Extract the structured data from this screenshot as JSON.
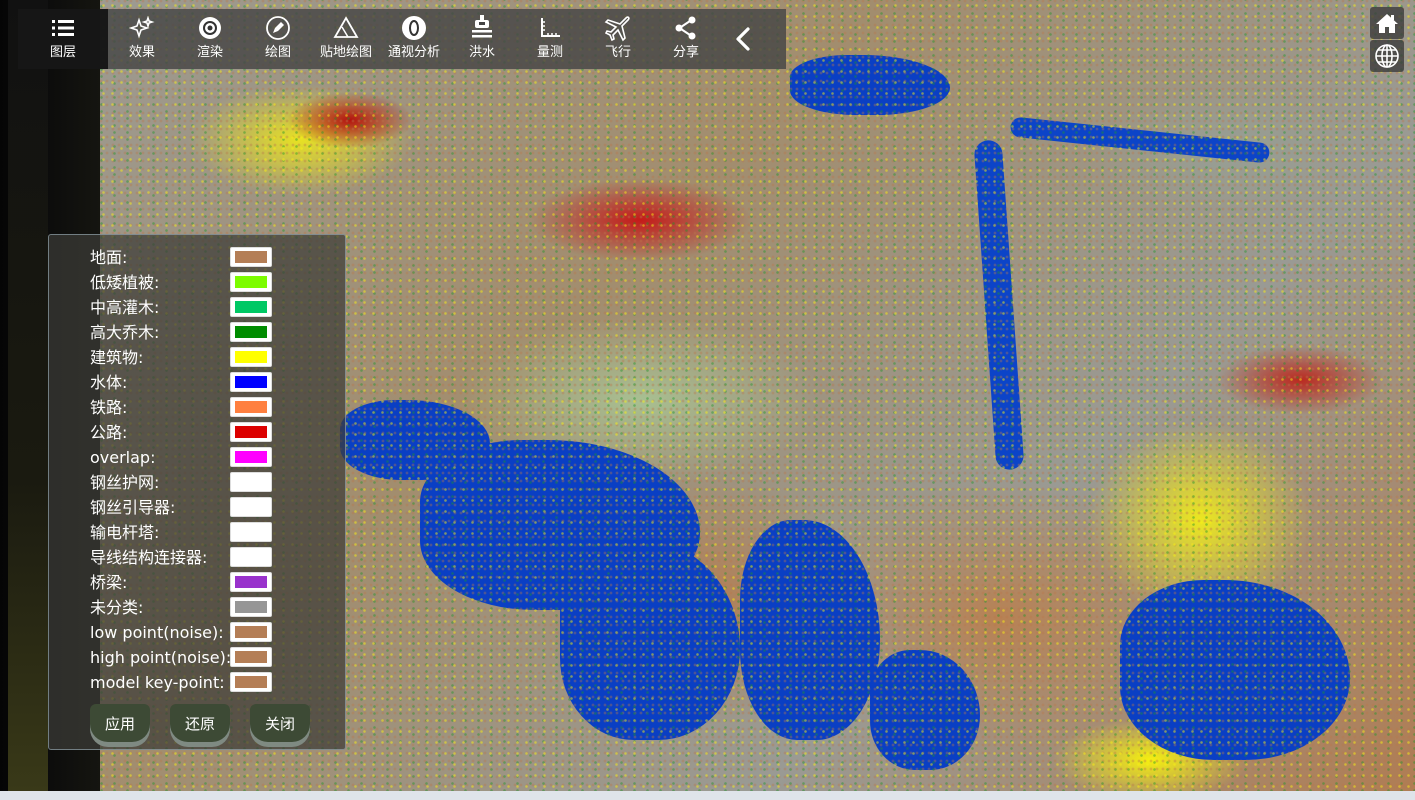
{
  "toolbar": {
    "items": [
      {
        "label": "图层",
        "icon": "layers-icon"
      },
      {
        "label": "效果",
        "icon": "sparkle-icon"
      },
      {
        "label": "渲染",
        "icon": "render-icon"
      },
      {
        "label": "绘图",
        "icon": "pen-icon"
      },
      {
        "label": "贴地绘图",
        "icon": "ground-draw-icon"
      },
      {
        "label": "通视分析",
        "icon": "visibility-icon"
      },
      {
        "label": "洪水",
        "icon": "flood-icon"
      },
      {
        "label": "量测",
        "icon": "ruler-icon"
      },
      {
        "label": "飞行",
        "icon": "plane-icon"
      },
      {
        "label": "分享",
        "icon": "share-icon"
      }
    ],
    "collapse_icon": "chevron-left-icon"
  },
  "right_buttons": {
    "home_icon": "home-icon",
    "globe_icon": "globe-icon"
  },
  "legend": {
    "rows": [
      {
        "label": "地面:",
        "color": "#b47e56"
      },
      {
        "label": "低矮植被:",
        "color": "#7cfc00"
      },
      {
        "label": "中高灌木:",
        "color": "#00c864"
      },
      {
        "label": "高大乔木:",
        "color": "#008c00"
      },
      {
        "label": "建筑物:",
        "color": "#ffff00"
      },
      {
        "label": "水体:",
        "color": "#0000ff"
      },
      {
        "label": "铁路:",
        "color": "#ff8040"
      },
      {
        "label": "公路:",
        "color": "#dc0000"
      },
      {
        "label": "overlap:",
        "color": "#ff00ff"
      },
      {
        "label": "钢丝护网:",
        "color": "#ffffff"
      },
      {
        "label": "钢丝引导器:",
        "color": "#ffffff"
      },
      {
        "label": "输电杆塔:",
        "color": "#ffffff"
      },
      {
        "label": "导线结构连接器:",
        "color": "#ffffff"
      },
      {
        "label": "桥梁:",
        "color": "#9932cc"
      },
      {
        "label": "未分类:",
        "color": "#969696"
      },
      {
        "label": "low point(noise):",
        "color": "#b47e56"
      },
      {
        "label": "high point(noise):",
        "color": "#b47e56"
      },
      {
        "label": "model key-point:",
        "color": "#b47e56"
      }
    ],
    "apply_label": "应用",
    "restore_label": "还原",
    "close_label": "关闭"
  }
}
